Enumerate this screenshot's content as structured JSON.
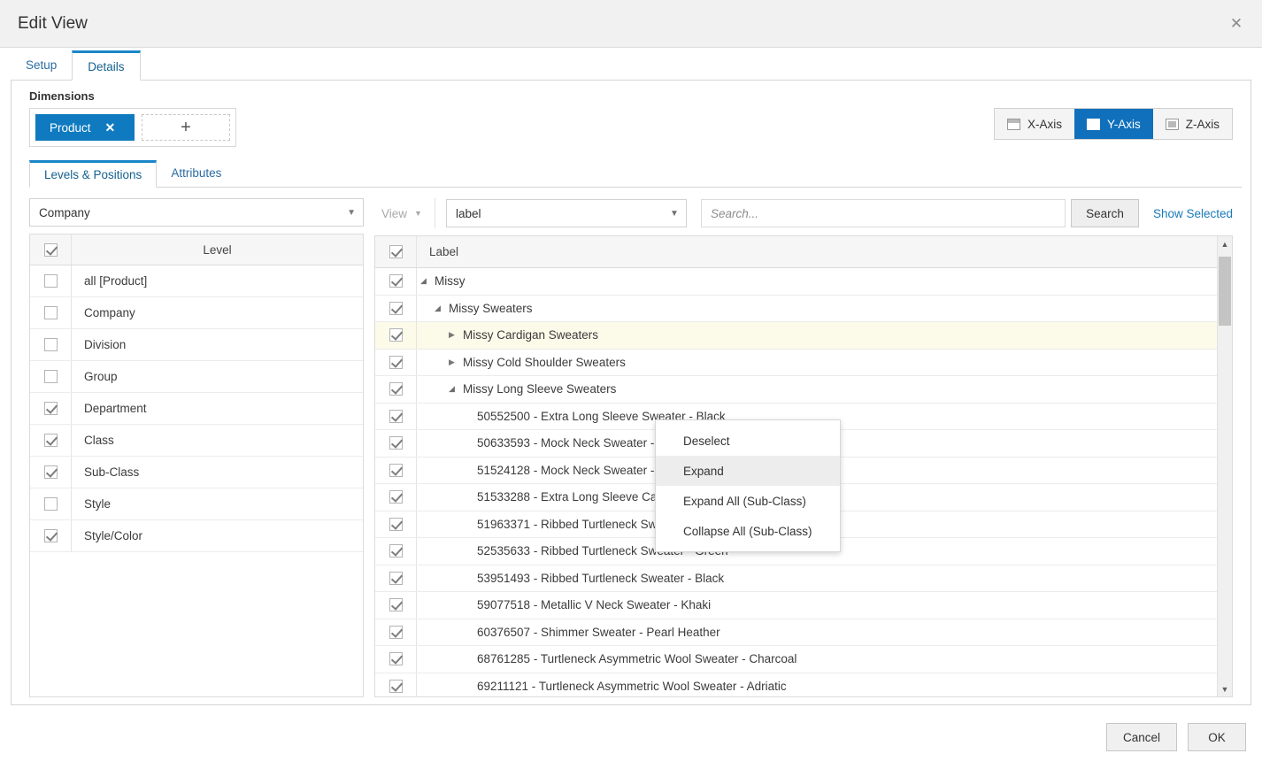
{
  "window": {
    "title": "Edit View",
    "close_icon": "close-icon"
  },
  "outer_tabs": [
    {
      "label": "Setup",
      "active": false
    },
    {
      "label": "Details",
      "active": true
    }
  ],
  "dimensions": {
    "heading": "Dimensions",
    "chips": [
      {
        "label": "Product",
        "remove_icon": "✕"
      }
    ],
    "add_icon": "✚"
  },
  "axis_buttons": [
    {
      "label": "X-Axis",
      "active": false,
      "icon": "x-axis-icon"
    },
    {
      "label": "Y-Axis",
      "active": true,
      "icon": "y-axis-icon"
    },
    {
      "label": "Z-Axis",
      "active": false,
      "icon": "z-axis-icon"
    }
  ],
  "inner_tabs": [
    {
      "label": "Levels & Positions",
      "active": true
    },
    {
      "label": "Attributes",
      "active": false
    }
  ],
  "left_panel": {
    "hierarchy_select": {
      "value": "Company",
      "caret": "▼"
    },
    "column_header": "Level",
    "header_checkbox_checked": true,
    "levels": [
      {
        "label": "all [Product]",
        "checked": false
      },
      {
        "label": "Company",
        "checked": false
      },
      {
        "label": "Division",
        "checked": false
      },
      {
        "label": "Group",
        "checked": false
      },
      {
        "label": "Department",
        "checked": true
      },
      {
        "label": "Class",
        "checked": true
      },
      {
        "label": "Sub-Class",
        "checked": true
      },
      {
        "label": "Style",
        "checked": false
      },
      {
        "label": "Style/Color",
        "checked": true
      }
    ]
  },
  "right_panel": {
    "view_button": {
      "label": "View",
      "caret": "▼"
    },
    "label_select": {
      "value": "label",
      "caret": "▼"
    },
    "search": {
      "value": "",
      "placeholder": "Search..."
    },
    "search_button": "Search",
    "show_selected_link": "Show Selected",
    "column_header": "Label",
    "header_checkbox_checked": true,
    "rows": [
      {
        "label": "Missy",
        "checked": true,
        "indent": 0,
        "twisty": "expanded",
        "highlight": false
      },
      {
        "label": "Missy Sweaters",
        "checked": true,
        "indent": 1,
        "twisty": "expanded",
        "highlight": false
      },
      {
        "label": "Missy Cardigan Sweaters",
        "checked": true,
        "indent": 2,
        "twisty": "collapsed",
        "highlight": true
      },
      {
        "label": "Missy Cold Shoulder Sweaters",
        "checked": true,
        "indent": 2,
        "twisty": "collapsed",
        "highlight": false
      },
      {
        "label": "Missy Long Sleeve Sweaters",
        "checked": true,
        "indent": 2,
        "twisty": "expanded",
        "highlight": false
      },
      {
        "label": "50552500 - Extra Long Sleeve Sweater - Black",
        "checked": true,
        "indent": 3,
        "twisty": "none",
        "highlight": false
      },
      {
        "label": "50633593 - Mock Neck Sweater - Grey",
        "checked": true,
        "indent": 3,
        "twisty": "none",
        "highlight": false
      },
      {
        "label": "51524128 - Mock Neck Sweater - Navy",
        "checked": true,
        "indent": 3,
        "twisty": "none",
        "highlight": false
      },
      {
        "label": "51533288 - Extra Long Sleeve Cardigan - Black",
        "checked": true,
        "indent": 3,
        "twisty": "none",
        "highlight": false
      },
      {
        "label": "51963371 - Ribbed Turtleneck Sweater - Prussian",
        "checked": true,
        "indent": 3,
        "twisty": "none",
        "highlight": false
      },
      {
        "label": "52535633 - Ribbed Turtleneck Sweater - Green",
        "checked": true,
        "indent": 3,
        "twisty": "none",
        "highlight": false
      },
      {
        "label": "53951493 - Ribbed Turtleneck Sweater - Black",
        "checked": true,
        "indent": 3,
        "twisty": "none",
        "highlight": false
      },
      {
        "label": "59077518 - Metallic V Neck Sweater - Khaki",
        "checked": true,
        "indent": 3,
        "twisty": "none",
        "highlight": false
      },
      {
        "label": "60376507 - Shimmer Sweater - Pearl Heather",
        "checked": true,
        "indent": 3,
        "twisty": "none",
        "highlight": false
      },
      {
        "label": "68761285 - Turtleneck Asymmetric Wool Sweater - Charcoal",
        "checked": true,
        "indent": 3,
        "twisty": "none",
        "highlight": false
      },
      {
        "label": "69211121 - Turtleneck Asymmetric Wool Sweater - Adriatic",
        "checked": true,
        "indent": 3,
        "twisty": "none",
        "highlight": false
      }
    ],
    "scrollbar": {
      "up_icon": "⌃",
      "down_icon": "⌄"
    }
  },
  "context_menu": [
    {
      "label": "Deselect",
      "active": false
    },
    {
      "label": "Expand",
      "active": true
    },
    {
      "label": "Expand All (Sub-Class)",
      "active": false
    },
    {
      "label": "Collapse All (Sub-Class)",
      "active": false
    }
  ],
  "footer": {
    "cancel_label": "Cancel",
    "ok_label": "OK"
  },
  "colors": {
    "accent": "#1070bc",
    "chip": "#0f7ac0",
    "link": "#1a7ab8",
    "highlight_row": "#fcfae9",
    "titlebar": "#f1f1f1"
  }
}
